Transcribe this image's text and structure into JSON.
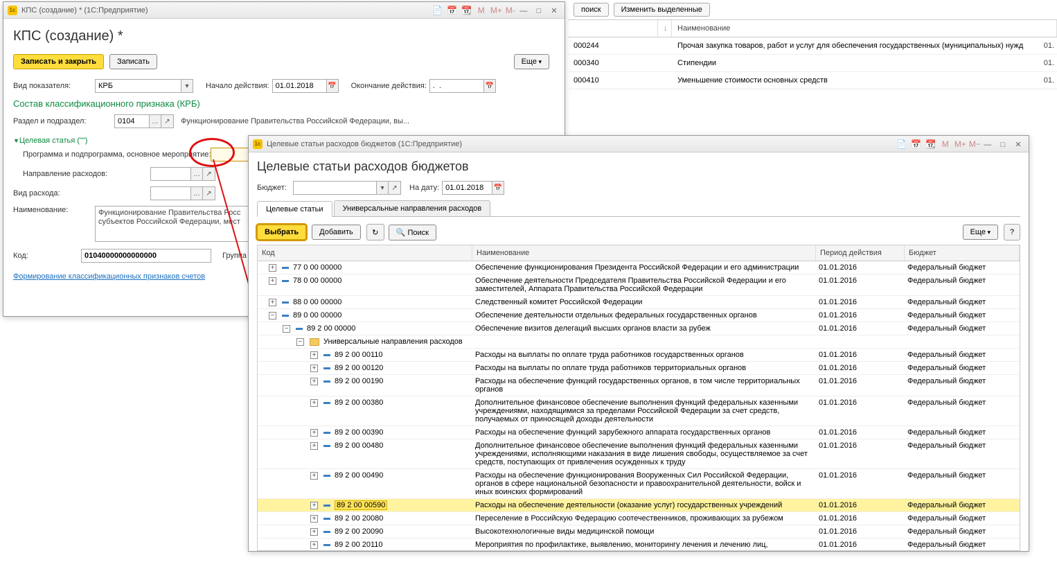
{
  "bg": {
    "btn_search": "поиск",
    "btn_edit": "Изменить выделенные",
    "col_name": "Наименование",
    "rows": [
      {
        "code": "000244",
        "name": "Прочая закупка товаров, работ и услуг для обеспечения государственных (муниципальных) нужд",
        "tail": "01."
      },
      {
        "code": "000340",
        "name": "Стипендии",
        "tail": "01."
      },
      {
        "code": "000410",
        "name": "Уменьшение стоимости основных средств",
        "tail": "01."
      }
    ]
  },
  "kps": {
    "title_bar": "КПС (создание) *  (1С:Предприятие)",
    "heading": "КПС (создание) *",
    "btn_save_close": "Записать и закрыть",
    "btn_save": "Записать",
    "btn_more": "Еще",
    "lbl_vid": "Вид показателя:",
    "val_vid": "КРБ",
    "lbl_start": "Начало действия:",
    "val_start": "01.01.2018",
    "lbl_end": "Окончание действия:",
    "val_end": ".  .",
    "section": "Состав классификационного признака (КРБ)",
    "lbl_razdel": "Раздел и подраздел:",
    "val_razdel": "0104",
    "text_razdel": "Функционирование Правительства Российской Федерации, вы...",
    "collapse": "Целевая статья (\"\")",
    "lbl_prog": "Программа и подпрограмма, основное мероприятие:",
    "lbl_napr": "Направление расходов:",
    "lbl_vidr": "Вид расхода:",
    "lbl_naim": "Наименование:",
    "val_naim": "Функционирование Правительства Росс субъектов Российской Федерации, мест",
    "lbl_kod": "Код:",
    "val_kod": "01040000000000000",
    "lbl_group": "Группа",
    "link": "Формирование классификационных признаков счетов"
  },
  "dlg": {
    "title_bar": "Целевые статьи расходов бюджетов (1С:Предприятие)",
    "tb_icons": [
      "M",
      "M+",
      "M−"
    ],
    "heading": "Целевые статьи расходов бюджетов",
    "lbl_budget": "Бюджет:",
    "lbl_date": "На дату:",
    "val_date": "01.01.2018",
    "tab1": "Целевые статьи",
    "tab2": "Универсальные направления расходов",
    "btn_select": "Выбрать",
    "btn_add": "Добавить",
    "btn_search": "Поиск",
    "btn_more": "Еще",
    "help": "?",
    "columns": {
      "code": "Код",
      "name": "Наименование",
      "period": "Период действия",
      "budget": "Бюджет"
    },
    "budget_val": "Федеральный бюджет",
    "rows": [
      {
        "ind": 1,
        "exp": "+",
        "code": "77 0 00 00000",
        "name": "Обеспечение функционирования Президента Российской Федерации и его администрации",
        "per": "01.01.2016"
      },
      {
        "ind": 1,
        "exp": "+",
        "code": "78 0 00 00000",
        "name": "Обеспечение деятельности Председателя Правительства Российской Федерации и его заместителей, Аппарата Правительства Российской Федерации",
        "per": "01.01.2016"
      },
      {
        "ind": 1,
        "exp": "+",
        "code": "88 0 00 00000",
        "name": "Следственный комитет Российской Федерации",
        "per": "01.01.2016"
      },
      {
        "ind": 1,
        "exp": "-",
        "code": "89 0 00 00000",
        "name": "Обеспечение деятельности отдельных федеральных государственных органов",
        "per": "01.01.2016"
      },
      {
        "ind": 2,
        "exp": "-",
        "code": "89 2 00 00000",
        "name": "Обеспечение визитов делегаций высших органов власти за рубеж",
        "per": "01.01.2016"
      },
      {
        "ind": 3,
        "exp": "-",
        "folder": true,
        "code": "Универсальные направления расходов",
        "name": "",
        "per": ""
      },
      {
        "ind": 4,
        "exp": "+",
        "code": "89 2 00 00110",
        "name": "Расходы на выплаты по оплате труда работников государственных органов",
        "per": "01.01.2016"
      },
      {
        "ind": 4,
        "exp": "+",
        "code": "89 2 00 00120",
        "name": "Расходы на выплаты по оплате труда работников территориальных органов",
        "per": "01.01.2016"
      },
      {
        "ind": 4,
        "exp": "+",
        "code": "89 2 00 00190",
        "name": "Расходы на обеспечение функций государственных органов, в том числе территориальных органов",
        "per": "01.01.2016"
      },
      {
        "ind": 4,
        "exp": "+",
        "code": "89 2 00 00380",
        "name": "Дополнительное финансовое обеспечение выполнения функций федеральных казенными учреждениями, находящимися за пределами Российской Федерации за счет средств, получаемых от приносящей доходы деятельности",
        "per": "01.01.2016"
      },
      {
        "ind": 4,
        "exp": "+",
        "code": "89 2 00 00390",
        "name": "Расходы на обеспечение функций зарубежного аппарата государственных органов",
        "per": "01.01.2016"
      },
      {
        "ind": 4,
        "exp": "+",
        "code": "89 2 00 00480",
        "name": "Дополнительное финансовое обеспечение выполнения функций федеральных казенными учреждениями, исполняющими наказания в виде лишения свободы, осуществляемое за счет средств, поступающих от привлечения осужденных к труду",
        "per": "01.01.2016"
      },
      {
        "ind": 4,
        "exp": "+",
        "code": "89 2 00 00490",
        "name": "Расходы на обеспечение функционирования Вооруженных Сил Российской Федерации, органов в сфере национальной безопасности и правоохранительной деятельности, войск и иных воинских формирований",
        "per": "01.01.2016"
      },
      {
        "ind": 4,
        "exp": "+",
        "sel": true,
        "code": "89 2 00 00590",
        "name": "Расходы на обеспечение деятельности (оказание услуг) государственных учреждений",
        "per": "01.01.2016"
      },
      {
        "ind": 4,
        "exp": "+",
        "code": "89 2 00 20080",
        "name": "Переселение в Российскую Федерацию соотечественников, проживающих за рубежом",
        "per": "01.01.2016"
      },
      {
        "ind": 4,
        "exp": "+",
        "code": "89 2 00 20090",
        "name": "Высокотехнологичные виды медицинской помощи",
        "per": "01.01.2016"
      },
      {
        "ind": 4,
        "exp": "+",
        "code": "89 2 00 20110",
        "name": "Мероприятия по профилактике, выявлению, мониторингу лечения и лечению лиц,",
        "per": "01.01.2016"
      }
    ]
  }
}
